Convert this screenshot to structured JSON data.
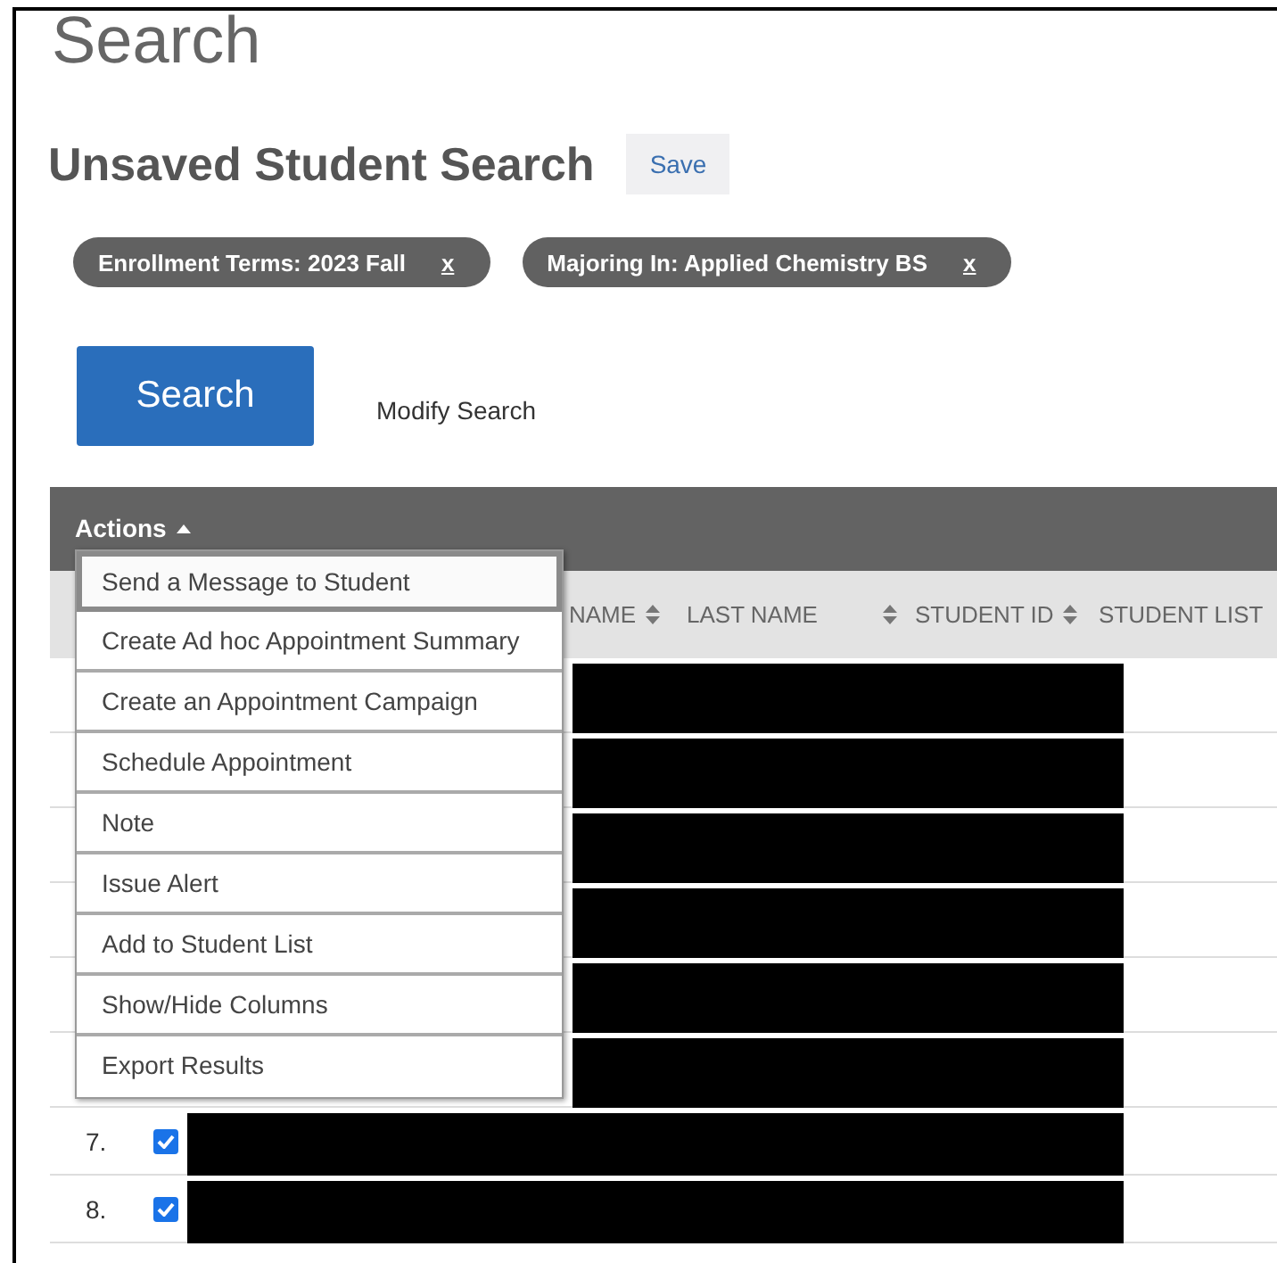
{
  "page_title": "Search",
  "search_title": "Unsaved Student Search",
  "save_button": "Save",
  "filters": [
    {
      "label": "Enrollment Terms: 2023 Fall",
      "remove_label": "x"
    },
    {
      "label": "Majoring In: Applied Chemistry BS",
      "remove_label": "x"
    }
  ],
  "search_button": "Search",
  "modify_link": "Modify Search",
  "table": {
    "actions_menu": {
      "label": "Actions",
      "expanded": true,
      "items": [
        {
          "label": "Send a Message to Student",
          "highlighted": true
        },
        {
          "label": "Create Ad hoc Appointment Summary",
          "highlighted": false
        },
        {
          "label": "Create an Appointment Campaign",
          "highlighted": false
        },
        {
          "label": "Schedule Appointment",
          "highlighted": false
        },
        {
          "label": "Note",
          "highlighted": false
        },
        {
          "label": "Issue Alert",
          "highlighted": false
        },
        {
          "label": "Add to Student List",
          "highlighted": false
        },
        {
          "label": "Show/Hide Columns",
          "highlighted": false
        },
        {
          "label": "Export Results",
          "highlighted": false
        }
      ]
    },
    "columns": [
      {
        "label": "NAME",
        "sortable": true
      },
      {
        "label": "LAST NAME",
        "sortable": true
      },
      {
        "label": "STUDENT ID",
        "sortable": true
      },
      {
        "label": "STUDENT LIST",
        "sortable": false
      }
    ],
    "rows": [
      {
        "kind": "covered",
        "redacted": true
      },
      {
        "kind": "covered",
        "redacted": true
      },
      {
        "kind": "covered",
        "redacted": true
      },
      {
        "kind": "covered",
        "redacted": true
      },
      {
        "kind": "covered",
        "redacted": true
      },
      {
        "kind": "covered",
        "redacted": true
      },
      {
        "kind": "visible",
        "number": "7.",
        "checked": true,
        "redacted": true
      },
      {
        "kind": "visible",
        "number": "8.",
        "checked": true,
        "redacted": true
      }
    ]
  }
}
